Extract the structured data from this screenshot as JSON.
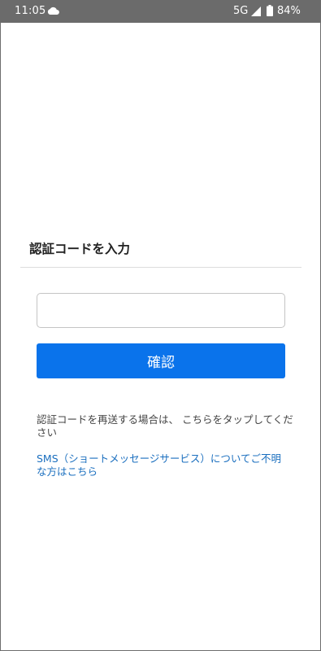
{
  "status_bar": {
    "time": "11:05",
    "network": "5G",
    "battery": "84%",
    "icons": [
      "cloud-icon",
      "signal-icon",
      "battery-icon"
    ]
  },
  "page": {
    "title": "認証コードを入力"
  },
  "form": {
    "code_value": "",
    "confirm_label": "確認"
  },
  "help": {
    "resend_text": "認証コードを再送する場合は、 こちらをタップしてください",
    "sms_link": "SMS（ショートメッセージサービス）についてご不明な方はこちら"
  },
  "colors": {
    "status_bar_bg": "#6b6b6b",
    "accent": "#0a73eb",
    "link": "#1b6fbf"
  }
}
